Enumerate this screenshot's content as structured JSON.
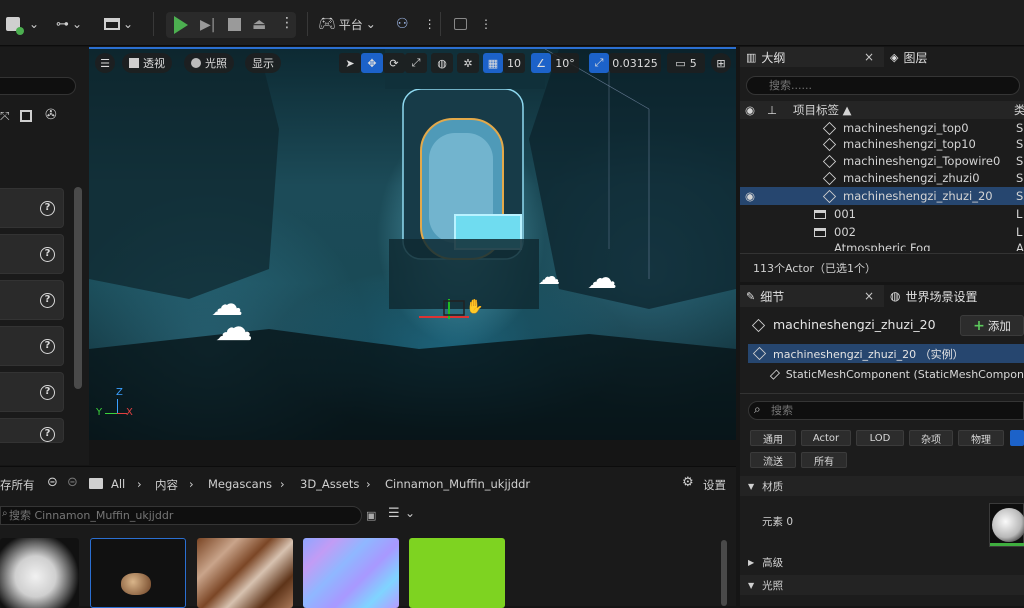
{
  "toolbar": {
    "platform_label": "平台"
  },
  "viewport": {
    "perspective_label": "透视",
    "lit_label": "光照",
    "show_label": "显示",
    "grid_snap": "10",
    "rotation_snap": "10°",
    "scale_snap": "0.03125",
    "camera_speed": "5",
    "axis_x": "X",
    "axis_y": "Y",
    "axis_z": "Z"
  },
  "content_browser": {
    "save_all": "存所有",
    "breadcrumbs": [
      "All",
      "内容",
      "Megascans",
      "3D_Assets",
      "Cinnamon_Muffin_ukjjddr"
    ],
    "settings": "设置",
    "search_placeholder": "搜索 Cinnamon_Muffin_ukjjddr"
  },
  "outliner": {
    "tab_outliner": "大纲",
    "tab_layers": "图层",
    "search_placeholder": "搜索......",
    "col_label": "项目标签 ▲",
    "col_type": "类",
    "rows": [
      {
        "label": "machineshengzi_top0",
        "type": "S"
      },
      {
        "label": "machineshengzi_top10",
        "type": "S"
      },
      {
        "label": "machineshengzi_Topowire0",
        "type": "S"
      },
      {
        "label": "machineshengzi_zhuzi0",
        "type": "S"
      },
      {
        "label": "machineshengzi_zhuzi_20",
        "type": "S"
      },
      {
        "label": "001",
        "type": "L"
      },
      {
        "label": "002",
        "type": "L"
      },
      {
        "label": "Atmospheric Fog",
        "type": "A"
      }
    ],
    "status": "113个Actor（已选1个）"
  },
  "details": {
    "tab_details": "细节",
    "tab_world": "世界场景设置",
    "actor_name": "machineshengzi_zhuzi_20",
    "add_button": "添加",
    "instance_row": "machineshengzi_zhuzi_20 （实例）",
    "component_row": "StaticMeshComponent (StaticMeshCompon",
    "search_placeholder": "搜索",
    "filters_row1": [
      "通用",
      "Actor",
      "LOD",
      "杂项",
      "物理"
    ],
    "filters_row2": [
      "流送",
      "所有"
    ],
    "section_material": "材质",
    "element_label": "元素 0",
    "section_advanced": "高级",
    "section_lighting": "光照"
  },
  "colors": {
    "accent": "#1c62c9",
    "selection": "#26466f",
    "play_green": "#4caf50"
  }
}
